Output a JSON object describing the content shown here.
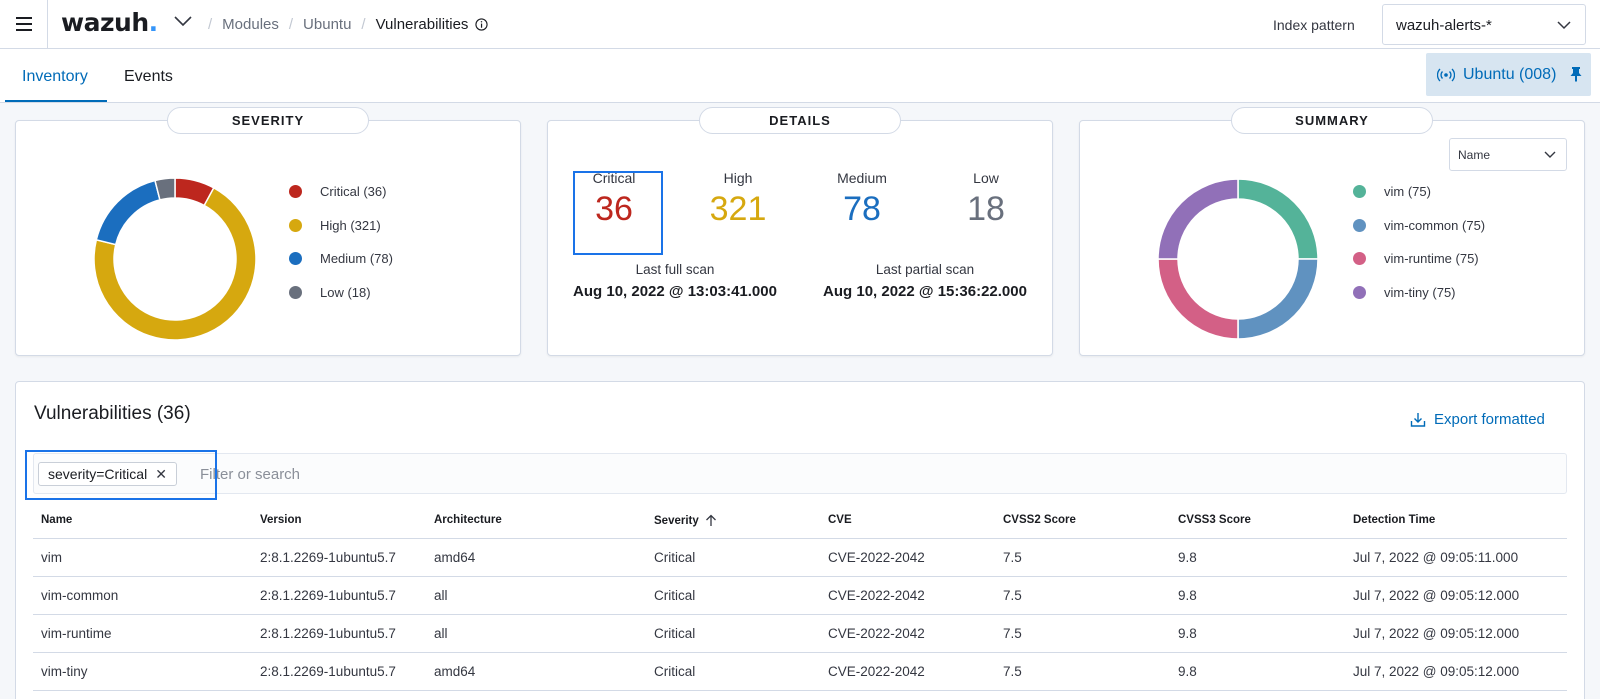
{
  "header": {
    "logo_main": "wazuh",
    "logo_dot": ".",
    "breadcrumb": [
      "Modules",
      "Ubuntu",
      "Vulnerabilities"
    ],
    "index_pattern_label": "Index pattern",
    "index_pattern_value": "wazuh-alerts-*"
  },
  "tabs": [
    {
      "label": "Inventory",
      "active": true
    },
    {
      "label": "Events",
      "active": false
    }
  ],
  "agent": {
    "label": "Ubuntu (008)"
  },
  "severity_panel": {
    "title": "SEVERITY",
    "legend": [
      {
        "label": "Critical (36)",
        "value": 36,
        "color": "#bd271e"
      },
      {
        "label": "High (321)",
        "value": 321,
        "color": "#d6a80f"
      },
      {
        "label": "Medium (78)",
        "value": 78,
        "color": "#1b6ebf"
      },
      {
        "label": "Low (18)",
        "value": 18,
        "color": "#69707d"
      }
    ]
  },
  "details_panel": {
    "title": "DETAILS",
    "counts": [
      {
        "label": "Critical",
        "value": "36",
        "color": "#bd271e"
      },
      {
        "label": "High",
        "value": "321",
        "color": "#d6a80f"
      },
      {
        "label": "Medium",
        "value": "78",
        "color": "#1b6ebf"
      },
      {
        "label": "Low",
        "value": "18",
        "color": "#69707d"
      }
    ],
    "last_full_scan_label": "Last full scan",
    "last_full_scan": "Aug 10, 2022 @ 13:03:41.000",
    "last_partial_scan_label": "Last partial scan",
    "last_partial_scan": "Aug 10, 2022 @ 15:36:22.000"
  },
  "summary_panel": {
    "title": "SUMMARY",
    "select_value": "Name",
    "legend": [
      {
        "label": "vim (75)",
        "value": 75,
        "color": "#54b399"
      },
      {
        "label": "vim-common (75)",
        "value": 75,
        "color": "#6092c0"
      },
      {
        "label": "vim-runtime (75)",
        "value": 75,
        "color": "#d36086"
      },
      {
        "label": "vim-tiny (75)",
        "value": 75,
        "color": "#9170b8"
      }
    ]
  },
  "vulnerabilities": {
    "title": "Vulnerabilities (36)",
    "export_label": "Export formatted",
    "filter_pill": "severity=Critical",
    "search_placeholder": "Filter or search",
    "columns": [
      "Name",
      "Version",
      "Architecture",
      "Severity",
      "CVE",
      "CVSS2 Score",
      "CVSS3 Score",
      "Detection Time"
    ],
    "rows": [
      [
        "vim",
        "2:8.1.2269-1ubuntu5.7",
        "amd64",
        "Critical",
        "CVE-2022-2042",
        "7.5",
        "9.8",
        "Jul 7, 2022 @ 09:05:11.000"
      ],
      [
        "vim-common",
        "2:8.1.2269-1ubuntu5.7",
        "all",
        "Critical",
        "CVE-2022-2042",
        "7.5",
        "9.8",
        "Jul 7, 2022 @ 09:05:12.000"
      ],
      [
        "vim-runtime",
        "2:8.1.2269-1ubuntu5.7",
        "all",
        "Critical",
        "CVE-2022-2042",
        "7.5",
        "9.8",
        "Jul 7, 2022 @ 09:05:12.000"
      ],
      [
        "vim-tiny",
        "2:8.1.2269-1ubuntu5.7",
        "amd64",
        "Critical",
        "CVE-2022-2042",
        "7.5",
        "9.8",
        "Jul 7, 2022 @ 09:05:12.000"
      ]
    ]
  }
}
